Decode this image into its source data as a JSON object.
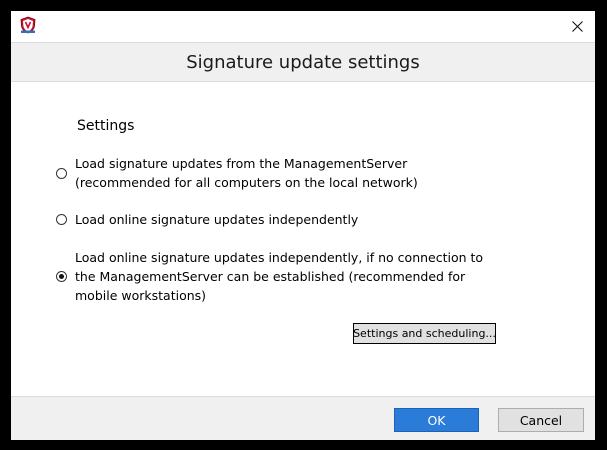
{
  "window": {
    "title": "",
    "app_icon": "shield-icon",
    "close_icon": "close-icon"
  },
  "header": {
    "title": "Signature update settings"
  },
  "settings": {
    "label": "Settings",
    "options": [
      {
        "lines": [
          "Load signature updates from the ManagementServer",
          "(recommended for all computers on the local network)"
        ],
        "selected": false
      },
      {
        "lines": [
          "Load online signature updates independently"
        ],
        "selected": false
      },
      {
        "lines": [
          "Load online signature updates independently, if no connection to",
          "the ManagementServer can be established (recommended for",
          "mobile workstations)"
        ],
        "selected": true
      }
    ],
    "scheduling_button": "Settings and scheduling..."
  },
  "footer": {
    "ok_label": "OK",
    "cancel_label": "Cancel"
  },
  "colors": {
    "accent": "#2b7bd8",
    "background": "#ffffff",
    "band": "#f0f0f0"
  }
}
